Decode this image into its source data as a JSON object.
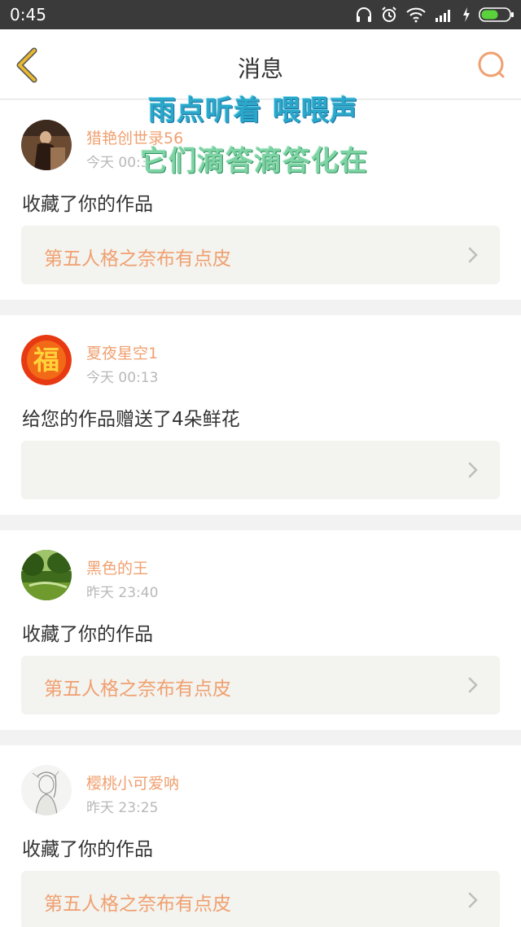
{
  "status_bar": {
    "time": "0:45"
  },
  "header": {
    "title": "消息"
  },
  "lyrics": [
    "雨点听着 喂喂声",
    "它们滴答滴答化在"
  ],
  "messages": [
    {
      "username": "猎艳创世录56",
      "time": "今天 00:3",
      "action": "收藏了你的作品",
      "work": "第五人格之奈布有点皮",
      "avatar": "photo-avatar"
    },
    {
      "username": "夏夜星空1",
      "time": "今天 00:13",
      "action": "给您的作品赠送了4朵鲜花",
      "work": "",
      "avatar": "fu-avatar"
    },
    {
      "username": "黑色的王",
      "time": "昨天 23:40",
      "action": "收藏了你的作品",
      "work": "第五人格之奈布有点皮",
      "avatar": "landscape-avatar"
    },
    {
      "username": "樱桃小可爱呐",
      "time": "昨天 23:25",
      "action": "收藏了你的作品",
      "work": "第五人格之奈布有点皮",
      "avatar": "sketch-avatar"
    }
  ],
  "avatar_fu_char": "福",
  "colors": {
    "accent": "#f0a070",
    "nav_back": "#e8b830",
    "status_bar": "#3a3a3a",
    "battery": "#5ad23c"
  }
}
